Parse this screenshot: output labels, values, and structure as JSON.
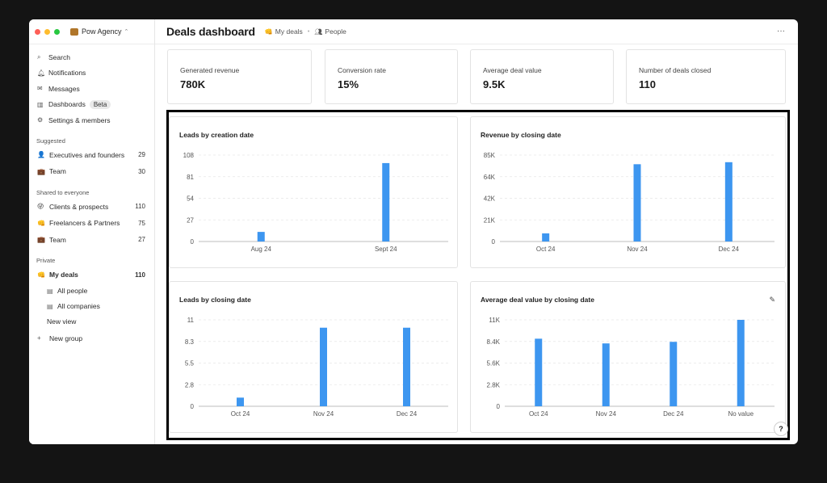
{
  "workspace": {
    "name": "Pow Agency"
  },
  "nav": [
    {
      "icon": "search-icon",
      "glyph": "⌕",
      "label": "Search"
    },
    {
      "icon": "bell-icon",
      "glyph": "♫",
      "label": "Notifications"
    },
    {
      "icon": "mail-icon",
      "glyph": "✉",
      "label": "Messages"
    },
    {
      "icon": "chart-icon",
      "glyph": "▥",
      "label": "Dashboards",
      "badge": "Beta"
    },
    {
      "icon": "gear-icon",
      "glyph": "⚙",
      "label": "Settings & members"
    }
  ],
  "sections": {
    "suggested": "Suggested",
    "shared": "Shared to everyone",
    "private": "Private"
  },
  "suggested": [
    {
      "label": "Executives and founders",
      "count": "29",
      "icon": "person-icon",
      "glyph": "👤"
    },
    {
      "label": "Team",
      "count": "30",
      "icon": "briefcase-icon",
      "glyph": "💼"
    }
  ],
  "shared": [
    {
      "label": "Clients & prospects",
      "count": "110",
      "icon": "smiley-icon",
      "glyph": "😜"
    },
    {
      "label": "Freelancers & Partners",
      "count": "75",
      "icon": "fist-icon",
      "glyph": "👊"
    },
    {
      "label": "Team",
      "count": "27",
      "icon": "briefcase-icon",
      "glyph": "💼"
    }
  ],
  "private": {
    "main": {
      "label": "My deals",
      "count": "110",
      "icon": "fist-icon",
      "glyph": "👊"
    },
    "subs": [
      {
        "label": "All people",
        "icon": "table-icon"
      },
      {
        "label": "All companies",
        "icon": "table-icon"
      }
    ],
    "new_view": "New view",
    "new_group": "New group"
  },
  "header": {
    "title": "Deals dashboard",
    "crumb1": "My deals",
    "crumb2": "People",
    "more": "···"
  },
  "stats": [
    {
      "label": "Generated revenue",
      "value": "780K"
    },
    {
      "label": "Conversion rate",
      "value": "15%"
    },
    {
      "label": "Average deal value",
      "value": "9.5K"
    },
    {
      "label": "Number of deals closed",
      "value": "110"
    }
  ],
  "help": "?",
  "colors": {
    "bar": "#3d96f0",
    "grid": "#e6e6e6",
    "axis": "#bdbdbd"
  },
  "chart_data": [
    {
      "type": "bar",
      "title": "Leads by creation date",
      "categories": [
        "Aug 24",
        "Sept 24"
      ],
      "values": [
        12,
        98
      ],
      "yticks": [
        "0",
        "27",
        "54",
        "81",
        "108"
      ],
      "ylim": [
        0,
        108
      ]
    },
    {
      "type": "bar",
      "title": "Revenue by closing date",
      "categories": [
        "Oct 24",
        "Nov 24",
        "Dec 24"
      ],
      "values": [
        8000,
        76000,
        78000
      ],
      "yticks": [
        "0",
        "21K",
        "42K",
        "64K",
        "85K"
      ],
      "ylim": [
        0,
        85000
      ]
    },
    {
      "type": "bar",
      "title": "Leads by closing date",
      "categories": [
        "Oct 24",
        "Nov 24",
        "Dec 24"
      ],
      "values": [
        1.1,
        10,
        10
      ],
      "yticks": [
        "0",
        "2.8",
        "5.5",
        "8.3",
        "11"
      ],
      "ylim": [
        0,
        11
      ]
    },
    {
      "type": "bar",
      "title": "Average deal value by closing date",
      "categories": [
        "Oct 24",
        "Nov 24",
        "Dec 24",
        "No value"
      ],
      "values": [
        8600,
        8000,
        8200,
        11000
      ],
      "yticks": [
        "0",
        "2.8K",
        "5.6K",
        "8.4K",
        "11K"
      ],
      "ylim": [
        0,
        11000
      ]
    }
  ]
}
